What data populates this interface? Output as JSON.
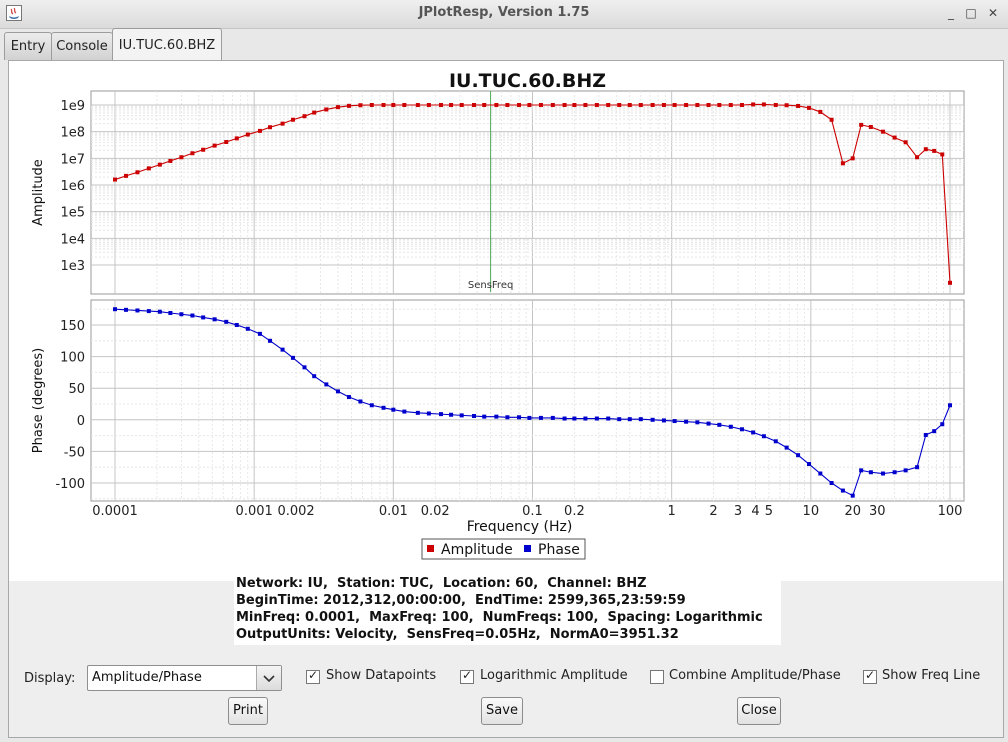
{
  "window": {
    "title": "JPlotResp, Version 1.75",
    "minimize": "_",
    "maximize": "□",
    "close": "✕"
  },
  "tabs": [
    {
      "label": "Entry"
    },
    {
      "label": "Console"
    },
    {
      "label": "IU.TUC.60.BHZ"
    }
  ],
  "colors": {
    "amplitude": "#cc0000",
    "phase": "#0000cc",
    "freq_line": "#4caa55",
    "grid": "#c8c8c8"
  },
  "chart_data": {
    "type": "line",
    "title": "IU.TUC.60.BHZ",
    "xlabel": "Frequency (Hz)",
    "x_scale": "log",
    "x_ticks": [
      "0.0001",
      "0.001",
      "0.002",
      "0.01",
      "0.02",
      "0.1",
      "0.2",
      "1",
      "2",
      "3",
      "4",
      "5",
      "10",
      "20",
      "30",
      "100"
    ],
    "freq_line": {
      "label": "SensFreq",
      "value": 0.05
    },
    "amplitude_panel": {
      "ylabel": "Amplitude",
      "y_scale": "log",
      "y_ticks": [
        "1e3",
        "1e4",
        "1e5",
        "1e6",
        "1e7",
        "1e8",
        "1e9"
      ],
      "ylim": [
        300,
        2000000000
      ]
    },
    "phase_panel": {
      "ylabel": "Phase (degrees)",
      "y_ticks": [
        "150",
        "100",
        "50",
        "0",
        "-50",
        "-100"
      ],
      "ylim": [
        -135,
        180
      ]
    },
    "series": [
      {
        "name": "Amplitude",
        "panel": "amplitude",
        "points": [
          [
            0.0001,
            1600000.0
          ],
          [
            0.00012,
            2200000.0
          ],
          [
            0.000145,
            3000000.0
          ],
          [
            0.000175,
            4200000.0
          ],
          [
            0.00021,
            5800000.0
          ],
          [
            0.00025,
            8000000.0
          ],
          [
            0.0003,
            11000000.0
          ],
          [
            0.00036,
            15500000.0
          ],
          [
            0.00043,
            21000000.0
          ],
          [
            0.00052,
            30000000.0
          ],
          [
            0.00063,
            41000000.0
          ],
          [
            0.00075,
            56000000.0
          ],
          [
            0.0009,
            78000000.0
          ],
          [
            0.0011,
            107000000.0
          ],
          [
            0.0013,
            147000000.0
          ],
          [
            0.0016,
            200000000.0
          ],
          [
            0.0019,
            280000000.0
          ],
          [
            0.0023,
            380000000.0
          ],
          [
            0.0027,
            520000000.0
          ],
          [
            0.0033,
            680000000.0
          ],
          [
            0.004,
            830000000.0
          ],
          [
            0.0048,
            930000000.0
          ],
          [
            0.0058,
            980000000.0
          ],
          [
            0.007,
            1000000000.0
          ],
          [
            0.0085,
            1000000000.0
          ],
          [
            0.01,
            1000000000.0
          ],
          [
            0.012,
            1000000000.0
          ],
          [
            0.015,
            1000000000.0
          ],
          [
            0.018,
            1000000000.0
          ],
          [
            0.022,
            1000000000.0
          ],
          [
            0.026,
            1000000000.0
          ],
          [
            0.031,
            1000000000.0
          ],
          [
            0.038,
            1000000000.0
          ],
          [
            0.045,
            1000000000.0
          ],
          [
            0.055,
            1000000000.0
          ],
          [
            0.066,
            1000000000.0
          ],
          [
            0.08,
            1000000000.0
          ],
          [
            0.095,
            1000000000.0
          ],
          [
            0.115,
            1000000000.0
          ],
          [
            0.14,
            1000000000.0
          ],
          [
            0.17,
            1000000000.0
          ],
          [
            0.2,
            1000000000.0
          ],
          [
            0.24,
            1000000000.0
          ],
          [
            0.29,
            1000000000.0
          ],
          [
            0.35,
            1000000000.0
          ],
          [
            0.42,
            1000000000.0
          ],
          [
            0.5,
            1000000000.0
          ],
          [
            0.6,
            1000000000.0
          ],
          [
            0.73,
            1000000000.0
          ],
          [
            0.88,
            1000000000.0
          ],
          [
            1.05,
            1000000000.0
          ],
          [
            1.27,
            1000000000.0
          ],
          [
            1.53,
            1000000000.0
          ],
          [
            1.84,
            1000000000.0
          ],
          [
            2.2,
            1000000000.0
          ],
          [
            2.66,
            1000000000.0
          ],
          [
            3.2,
            1000000000.0
          ],
          [
            3.85,
            1050000000.0
          ],
          [
            4.6,
            1050000000.0
          ],
          [
            5.6,
            1000000000.0
          ],
          [
            6.7,
            980000000.0
          ],
          [
            8.1,
            920000000.0
          ],
          [
            9.7,
            780000000.0
          ],
          [
            11.7,
            550000000.0
          ],
          [
            14.1,
            280000000.0
          ],
          [
            17,
            6500000.0
          ],
          [
            20,
            10000000.0
          ],
          [
            23,
            180000000.0
          ],
          [
            27,
            150000000.0
          ],
          [
            33,
            100000000.0
          ],
          [
            40,
            60000000.0
          ],
          [
            48,
            40000000.0
          ],
          [
            58,
            11000000.0
          ],
          [
            67,
            22000000.0
          ],
          [
            77,
            19000000.0
          ],
          [
            88,
            14000000.0
          ],
          [
            100,
            215
          ]
        ]
      },
      {
        "name": "Phase",
        "panel": "phase",
        "points": [
          [
            0.0001,
            175
          ],
          [
            0.00012,
            174
          ],
          [
            0.000145,
            173
          ],
          [
            0.000175,
            172
          ],
          [
            0.00021,
            171
          ],
          [
            0.00025,
            169
          ],
          [
            0.0003,
            167
          ],
          [
            0.00036,
            165
          ],
          [
            0.00043,
            162
          ],
          [
            0.00052,
            159
          ],
          [
            0.00063,
            155
          ],
          [
            0.00075,
            150
          ],
          [
            0.0009,
            144
          ],
          [
            0.0011,
            136
          ],
          [
            0.0013,
            125
          ],
          [
            0.0016,
            111
          ],
          [
            0.0019,
            98
          ],
          [
            0.0023,
            83
          ],
          [
            0.0027,
            69
          ],
          [
            0.0033,
            56
          ],
          [
            0.004,
            45
          ],
          [
            0.0048,
            36
          ],
          [
            0.0058,
            29
          ],
          [
            0.007,
            23
          ],
          [
            0.0085,
            19
          ],
          [
            0.01,
            16
          ],
          [
            0.012,
            13
          ],
          [
            0.015,
            11
          ],
          [
            0.018,
            10
          ],
          [
            0.022,
            9
          ],
          [
            0.026,
            8
          ],
          [
            0.031,
            7
          ],
          [
            0.038,
            6
          ],
          [
            0.045,
            5
          ],
          [
            0.055,
            5
          ],
          [
            0.066,
            4
          ],
          [
            0.08,
            4
          ],
          [
            0.095,
            3
          ],
          [
            0.115,
            3
          ],
          [
            0.14,
            3
          ],
          [
            0.17,
            2
          ],
          [
            0.2,
            2
          ],
          [
            0.24,
            2
          ],
          [
            0.29,
            2
          ],
          [
            0.35,
            2
          ],
          [
            0.42,
            1
          ],
          [
            0.5,
            1
          ],
          [
            0.6,
            1
          ],
          [
            0.73,
            0
          ],
          [
            0.88,
            -1
          ],
          [
            1.05,
            -2
          ],
          [
            1.27,
            -3
          ],
          [
            1.53,
            -4
          ],
          [
            1.84,
            -6
          ],
          [
            2.2,
            -8
          ],
          [
            2.66,
            -11
          ],
          [
            3.2,
            -15
          ],
          [
            3.85,
            -20
          ],
          [
            4.6,
            -26
          ],
          [
            5.6,
            -34
          ],
          [
            6.7,
            -44
          ],
          [
            8.1,
            -56
          ],
          [
            9.7,
            -70
          ],
          [
            11.7,
            -85
          ],
          [
            14.1,
            -100
          ],
          [
            17,
            -112
          ],
          [
            20,
            -120
          ],
          [
            23,
            -80
          ],
          [
            27,
            -83
          ],
          [
            33,
            -85
          ],
          [
            40,
            -83
          ],
          [
            48,
            -80
          ],
          [
            58,
            -75
          ],
          [
            67,
            -24
          ],
          [
            77,
            -18
          ],
          [
            88,
            -7
          ],
          [
            100,
            23
          ]
        ]
      }
    ],
    "legend": {
      "items": [
        "Amplitude",
        "Phase"
      ],
      "position": "bottom"
    }
  },
  "info": {
    "line1": "Network: IU,  Station: TUC,  Location: 60,  Channel: BHZ",
    "line2": "BeginTime: 2012,312,00:00:00,  EndTime: 2599,365,23:59:59",
    "line3": "MinFreq: 0.0001,  MaxFreq: 100,  NumFreqs: 100,  Spacing: Logarithmic",
    "line4": "OutputUnits: Velocity,  SensFreq=0.05Hz,  NormA0=3951.32"
  },
  "controls": {
    "display_label": "Display:",
    "display_value": "Amplitude/Phase",
    "show_datapoints": {
      "label": "Show Datapoints",
      "checked": true
    },
    "log_amplitude": {
      "label": "Logarithmic Amplitude",
      "checked": true
    },
    "combine": {
      "label": "Combine Amplitude/Phase",
      "checked": false
    },
    "show_freq_line": {
      "label": "Show Freq Line",
      "checked": true
    }
  },
  "buttons": {
    "print": "Print",
    "save": "Save",
    "close": "Close"
  }
}
